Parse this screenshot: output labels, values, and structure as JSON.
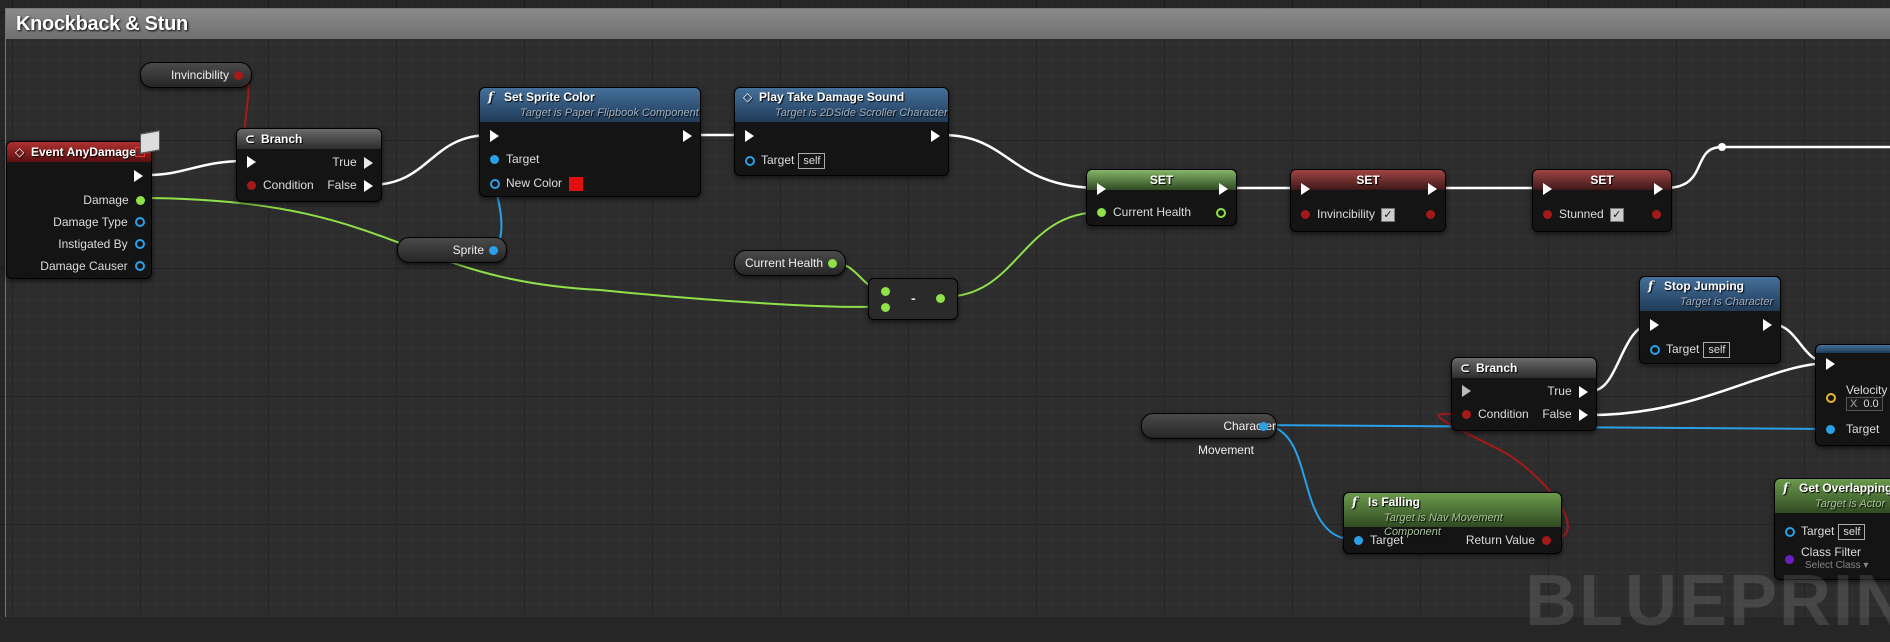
{
  "comment": {
    "title": "Knockback & Stun"
  },
  "colors": {
    "exec": "#ffffff",
    "bool": "#a41a1a",
    "float": "#8fe04a",
    "object": "#29a1e8",
    "class": "#6a1fc4"
  },
  "nodes": {
    "event_any_damage": {
      "title": "Event AnyDamage",
      "pins": [
        "Damage",
        "Damage Type",
        "Instigated By",
        "Damage Causer"
      ]
    },
    "invincibility_get": {
      "label": "Invincibility"
    },
    "branch1": {
      "title": "Branch",
      "condition": "Condition",
      "true": "True",
      "false": "False"
    },
    "set_sprite_color": {
      "title": "Set Sprite Color",
      "subtitle": "Target is Paper Flipbook Component",
      "target": "Target",
      "new_color": "New Color",
      "color_value": "#e01010"
    },
    "play_sound": {
      "title": "Play Take Damage Sound",
      "subtitle": "Target is 2DSide Scroller Character",
      "target": "Target",
      "self": "self"
    },
    "sprite_get": {
      "label": "Sprite"
    },
    "current_health_get": {
      "label": "Current Health"
    },
    "subtract": {
      "label": "-"
    },
    "set_health": {
      "title": "SET",
      "pin": "Current Health"
    },
    "set_invincibility": {
      "title": "SET",
      "pin": "Invincibility"
    },
    "set_stunned": {
      "title": "SET",
      "pin": "Stunned"
    },
    "stop_jumping": {
      "title": "Stop Jumping",
      "subtitle": "Target is Character",
      "target": "Target",
      "self": "self"
    },
    "branch2": {
      "title": "Branch",
      "condition": "Condition",
      "true": "True",
      "false": "False"
    },
    "launch": {
      "velocity": "Velocity",
      "x_label": "X",
      "x_value": "0.0",
      "target": "Target"
    },
    "char_movement_get": {
      "label": "Character Movement"
    },
    "is_falling": {
      "title": "Is Falling",
      "subtitle": "Target is Nav Movement Component",
      "target": "Target",
      "return": "Return Value"
    },
    "get_overlapping": {
      "title": "Get Overlapping A",
      "subtitle": "Target is Actor",
      "target": "Target",
      "self": "self",
      "class_filter": "Class Filter",
      "select_class": "Select Class"
    }
  },
  "watermark": "BLUEPRINT"
}
